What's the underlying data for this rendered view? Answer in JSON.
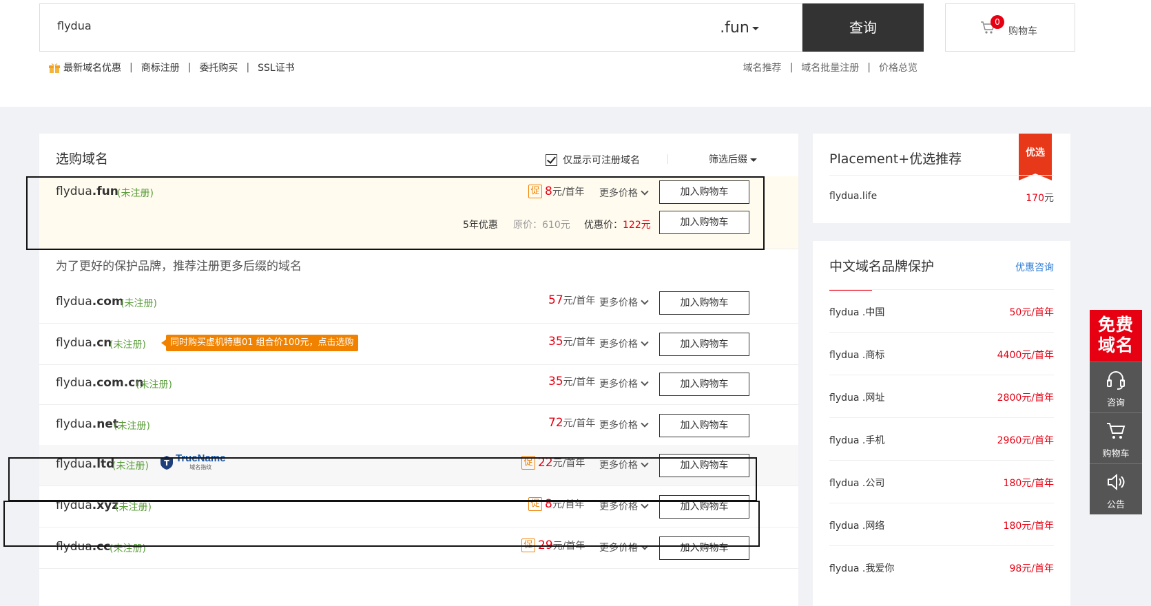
{
  "search": {
    "value": "flydua",
    "suffix": ".fun",
    "query_label": "查询"
  },
  "cart": {
    "count": "0",
    "label": "购物车"
  },
  "subnav_left": [
    "最新域名优惠",
    "商标注册",
    "委托购买",
    "SSL证书"
  ],
  "subnav_right": [
    "域名推荐",
    "域名批量注册",
    "价格总览"
  ],
  "main": {
    "title": "选购域名",
    "filter_label": "仅显示可注册域名",
    "filter_suffix": "筛选后缀",
    "recommend_text": "为了更好的保护品牌，推荐注册更多后缀的域名",
    "unit": "元/首年",
    "more_label": "更多价格",
    "add_label": "加入购物车",
    "status": "(未注册)",
    "promo_char": "促",
    "featured": {
      "name": "flydua",
      "tld": ".fun",
      "price": "8",
      "bundle": {
        "years": "5年优惠",
        "orig_label": "原价：",
        "orig_price": "610元",
        "deal_label": "优惠价：",
        "deal_price": "122元"
      }
    },
    "rows": [
      {
        "name": "flydua",
        "tld": ".com",
        "price": "57",
        "promo": false
      },
      {
        "name": "flydua",
        "tld": ".cn",
        "price": "35",
        "promo": false,
        "banner": "同时购买虚机特惠01 组合价100元，点击选购"
      },
      {
        "name": "flydua",
        "tld": ".com.cn",
        "price": "35",
        "promo": false
      },
      {
        "name": "flydua",
        "tld": ".net",
        "price": "72",
        "promo": false
      },
      {
        "name": "flydua",
        "tld": ".ltd",
        "price": "22",
        "promo": true,
        "badge_text": "TrueName",
        "badge_sub": "域名指纹"
      },
      {
        "name": "flydua",
        "tld": ".xyz",
        "price": "8",
        "promo": true
      },
      {
        "name": "flydua",
        "tld": ".cc",
        "price": "29",
        "promo": true
      }
    ]
  },
  "placement": {
    "title": "Placement+优选推荐",
    "ribbon": "优选",
    "items": [
      {
        "name": "flydua.life",
        "price": "170",
        "unit": "元"
      }
    ]
  },
  "cn_domain": {
    "title": "中文域名品牌保护",
    "consult": "优惠咨询",
    "unit": "元/首年",
    "items": [
      {
        "name": "flydua .中国",
        "price": "50"
      },
      {
        "name": "flydua .商标",
        "price": "4400"
      },
      {
        "name": "flydua .网址",
        "price": "2800"
      },
      {
        "name": "flydua .手机",
        "price": "2960"
      },
      {
        "name": "flydua .公司",
        "price": "180"
      },
      {
        "name": "flydua .网络",
        "price": "180"
      },
      {
        "name": "flydua .我爱你",
        "price": "98"
      }
    ]
  },
  "rail": {
    "free": "免费域名",
    "consult": "咨询",
    "cart": "购物车",
    "notice": "公告"
  }
}
